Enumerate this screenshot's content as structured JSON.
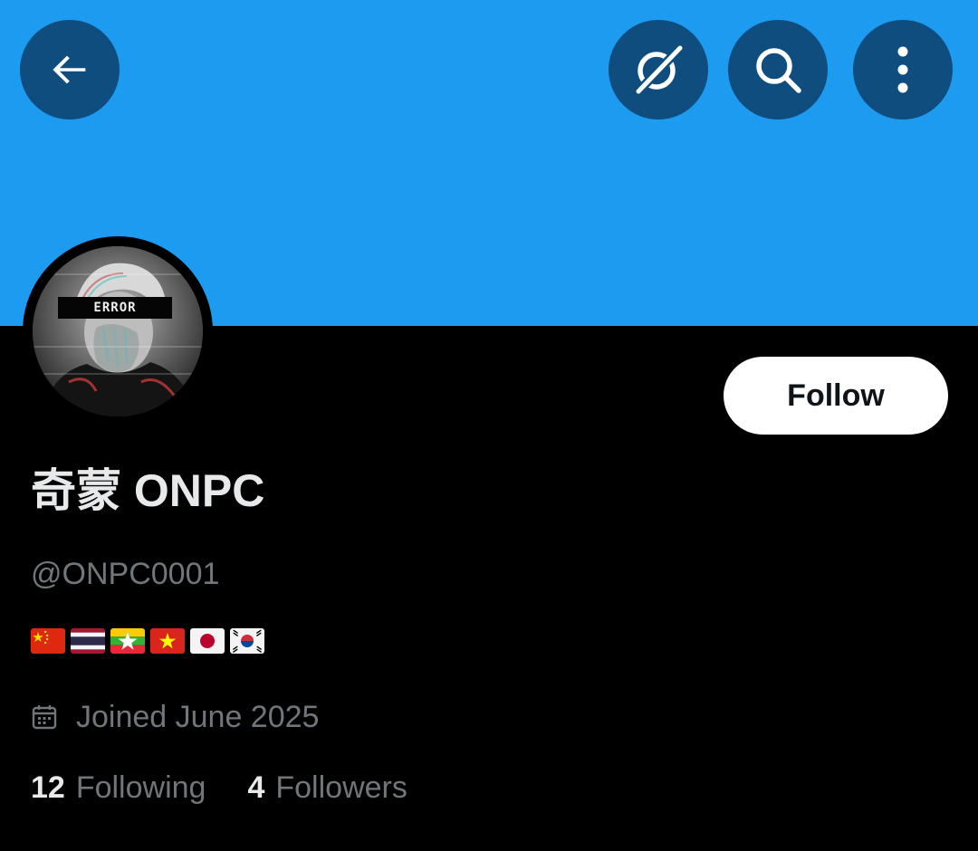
{
  "profile": {
    "display_name": "奇蒙 ONPC",
    "handle": "@ONPC0001",
    "bio_flags": [
      "china-flag",
      "thailand-flag",
      "myanmar-flag",
      "vietnam-flag",
      "japan-flag",
      "south-korea-flag"
    ],
    "joined": "Joined June 2025",
    "avatar_caption": "ERROR"
  },
  "actions": {
    "follow_label": "Follow"
  },
  "stats": {
    "following_count": "12",
    "following_label": "Following",
    "followers_count": "4",
    "followers_label": "Followers"
  },
  "icons": {
    "back": "arrow-left-icon",
    "grok": "grok-icon",
    "search": "search-icon",
    "more": "more-vertical-icon",
    "calendar": "calendar-icon"
  },
  "colors": {
    "banner": "#1d9bf0",
    "header_button": "#0e4d7d",
    "text_primary": "#e7e9ea",
    "text_secondary": "#71767b"
  }
}
